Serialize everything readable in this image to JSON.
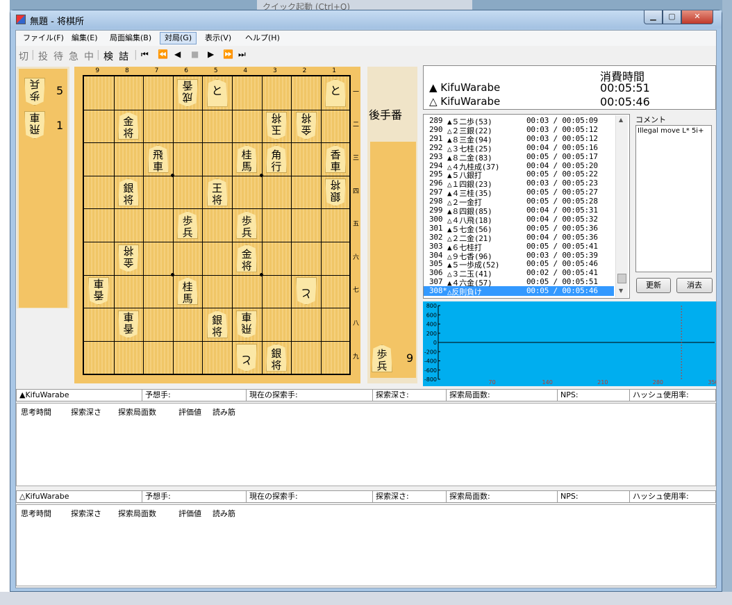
{
  "desktop": {
    "quick_launch": "クイック起動 (Ctrl+Q)"
  },
  "window": {
    "title": "無題 - 将棋所"
  },
  "menu": [
    "ファイル(F)",
    "編集(E)",
    "局面編集(B)",
    "対局(G)",
    "表示(V)",
    "ヘルプ(H)"
  ],
  "toolbar": {
    "kanji_buttons": [
      "切",
      "投",
      "待",
      "急",
      "中",
      "検",
      "詰"
    ],
    "nav_icons": [
      "⏮",
      "⏪",
      "◀",
      "■",
      "▶",
      "⏩",
      "⏭"
    ]
  },
  "board": {
    "files": [
      "9",
      "8",
      "7",
      "6",
      "5",
      "4",
      "3",
      "2",
      "1"
    ],
    "ranks": [
      "一",
      "二",
      "三",
      "四",
      "五",
      "六",
      "七",
      "八",
      "九"
    ],
    "gote_label": "後手番",
    "gote_hand": [
      {
        "piece": "歩兵",
        "count": "5"
      },
      {
        "piece": "飛車",
        "count": "1"
      }
    ],
    "sente_hand": [
      {
        "piece": "歩兵",
        "count": "9"
      }
    ]
  },
  "clock": {
    "header": "消費時間",
    "sente_name": "▲ KifuWarabe",
    "sente_time": "00:05:51",
    "gote_name": "△ KifuWarabe",
    "gote_time": "00:05:46"
  },
  "moves": [
    {
      "no": "289",
      "text": "▲５二歩(53)",
      "t": "00:03 / 00:05:09"
    },
    {
      "no": "290",
      "text": "△２三銀(22)",
      "t": "00:03 / 00:05:12"
    },
    {
      "no": "291",
      "text": "▲８三金(94)",
      "t": "00:03 / 00:05:12"
    },
    {
      "no": "292",
      "text": "△３七桂(25)",
      "t": "00:04 / 00:05:16"
    },
    {
      "no": "293",
      "text": "▲８二金(83)",
      "t": "00:05 / 00:05:17"
    },
    {
      "no": "294",
      "text": "△４九桂成(37)",
      "t": "00:04 / 00:05:20"
    },
    {
      "no": "295",
      "text": "▲５八銀打",
      "t": "00:05 / 00:05:22"
    },
    {
      "no": "296",
      "text": "△１四銀(23)",
      "t": "00:03 / 00:05:23"
    },
    {
      "no": "297",
      "text": "▲４三桂(35)",
      "t": "00:05 / 00:05:27"
    },
    {
      "no": "298",
      "text": "△２一金打",
      "t": "00:05 / 00:05:28"
    },
    {
      "no": "299",
      "text": "▲８四銀(85)",
      "t": "00:04 / 00:05:31"
    },
    {
      "no": "300",
      "text": "△４八飛(18)",
      "t": "00:04 / 00:05:32"
    },
    {
      "no": "301",
      "text": "▲５七金(56)",
      "t": "00:05 / 00:05:36"
    },
    {
      "no": "302",
      "text": "△２二金(21)",
      "t": "00:04 / 00:05:36"
    },
    {
      "no": "303",
      "text": "▲６七桂打",
      "t": "00:05 / 00:05:41"
    },
    {
      "no": "304",
      "text": "△９七香(96)",
      "t": "00:03 / 00:05:39"
    },
    {
      "no": "305",
      "text": "▲５一歩成(52)",
      "t": "00:05 / 00:05:46"
    },
    {
      "no": "306",
      "text": "△３二玉(41)",
      "t": "00:02 / 00:05:41"
    },
    {
      "no": "307",
      "text": "▲４六金(57)",
      "t": "00:05 / 00:05:51"
    },
    {
      "no": "308*",
      "text": "△反則負け",
      "t": "00:05 / 00:05:46"
    }
  ],
  "comment": {
    "label": "コメント",
    "text": "Illegal move L* 5i+",
    "update": "更新",
    "delete": "消去"
  },
  "graph": {
    "y_ticks": [
      "800",
      "600",
      "400",
      "200",
      "0",
      "-200",
      "-400",
      "-600",
      "-800"
    ],
    "x_ticks": [
      "70",
      "140",
      "210",
      "280",
      "350"
    ]
  },
  "engine1": {
    "name": "▲KifuWarabe",
    "fields": [
      "予想手:",
      "現在の探索手:",
      "探索深さ:",
      "探索局面数:",
      "NPS:",
      "ハッシュ使用率:"
    ],
    "columns": [
      "思考時間",
      "探索深さ",
      "探索局面数",
      "評価値",
      "読み筋"
    ]
  },
  "engine2": {
    "name": "△KifuWarabe",
    "fields": [
      "予想手:",
      "現在の探索手:",
      "探索深さ:",
      "探索局面数:",
      "NPS:",
      "ハッシュ使用率:"
    ],
    "columns": [
      "思考時間",
      "探索深さ",
      "探索局面数",
      "評価値",
      "読み筋"
    ]
  },
  "pieces": [
    {
      "f": "6",
      "r": "一",
      "t": "成香",
      "g": true
    },
    {
      "f": "5",
      "r": "一",
      "t": "と",
      "g": false
    },
    {
      "f": "1",
      "r": "一",
      "t": "と",
      "g": false
    },
    {
      "f": "8",
      "r": "二",
      "t": "金将",
      "g": false
    },
    {
      "f": "3",
      "r": "二",
      "t": "玉将",
      "g": true
    },
    {
      "f": "2",
      "r": "二",
      "t": "金将",
      "g": true
    },
    {
      "f": "7",
      "r": "三",
      "t": "飛車",
      "g": false
    },
    {
      "f": "4",
      "r": "三",
      "t": "桂馬",
      "g": false
    },
    {
      "f": "3",
      "r": "三",
      "t": "角行",
      "g": false
    },
    {
      "f": "1",
      "r": "三",
      "t": "香車",
      "g": false
    },
    {
      "f": "8",
      "r": "四",
      "t": "銀将",
      "g": false
    },
    {
      "f": "5",
      "r": "四",
      "t": "王将",
      "g": false
    },
    {
      "f": "1",
      "r": "四",
      "t": "銀将",
      "g": true
    },
    {
      "f": "6",
      "r": "五",
      "t": "歩兵",
      "g": false
    },
    {
      "f": "4",
      "r": "五",
      "t": "歩兵",
      "g": false
    },
    {
      "f": "8",
      "r": "六",
      "t": "金将",
      "g": true
    },
    {
      "f": "4",
      "r": "六",
      "t": "金将",
      "g": false
    },
    {
      "f": "9",
      "r": "七",
      "t": "香車",
      "g": true
    },
    {
      "f": "6",
      "r": "七",
      "t": "桂馬",
      "g": false
    },
    {
      "f": "2",
      "r": "七",
      "t": "と",
      "g": true
    },
    {
      "f": "8",
      "r": "八",
      "t": "香車",
      "g": true
    },
    {
      "f": "5",
      "r": "八",
      "t": "銀将",
      "g": false
    },
    {
      "f": "4",
      "r": "八",
      "t": "飛車",
      "g": true
    },
    {
      "f": "4",
      "r": "九",
      "t": "と",
      "g": true
    },
    {
      "f": "3",
      "r": "九",
      "t": "銀将",
      "g": false
    }
  ],
  "colors": {
    "board": "#f3c465",
    "graph": "#00aeef",
    "selection": "#3399ff"
  }
}
